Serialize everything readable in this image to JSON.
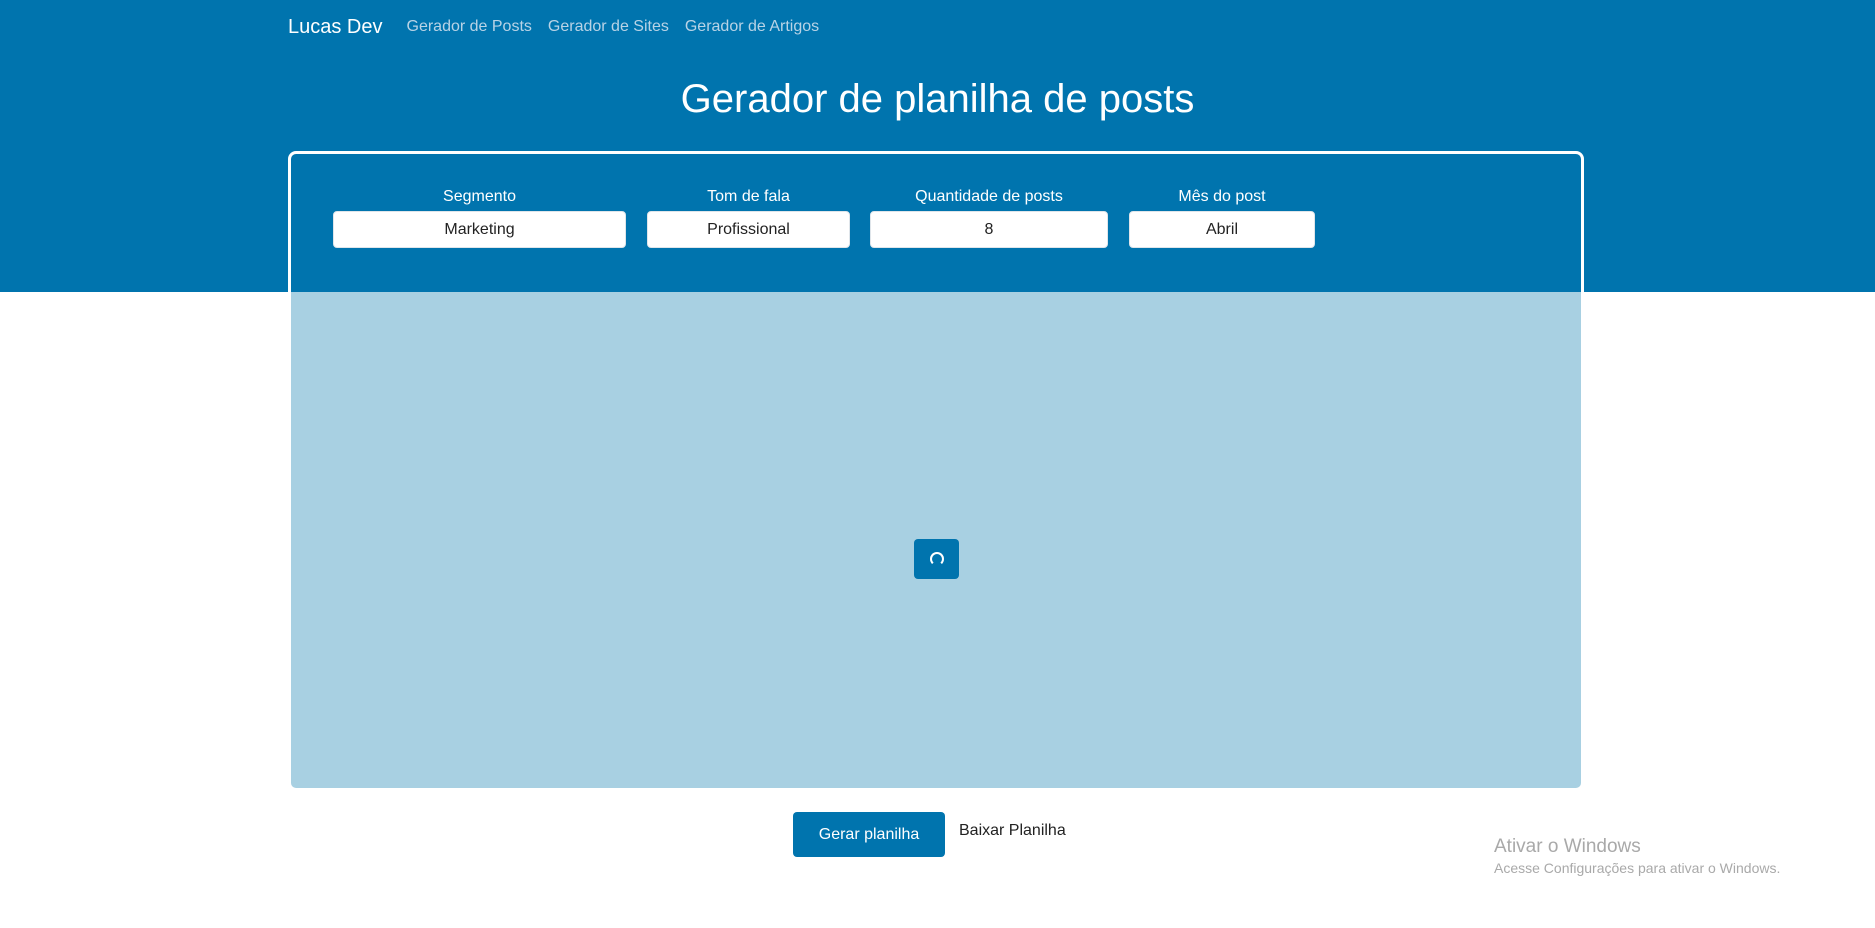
{
  "nav": {
    "brand": "Lucas Dev",
    "links": [
      "Gerador de Posts",
      "Gerador de Sites",
      "Gerador de Artigos"
    ]
  },
  "page_title": "Gerador de planilha de posts",
  "form": {
    "fields": [
      {
        "label": "Segmento",
        "value": "Marketing"
      },
      {
        "label": "Tom de fala",
        "value": "Profissional"
      },
      {
        "label": "Quantidade de posts",
        "value": "8"
      },
      {
        "label": "Mês do post",
        "value": "Abril"
      }
    ]
  },
  "actions": {
    "generate_label": "Gerar planilha",
    "download_label": "Baixar Planilha"
  },
  "watermark": {
    "title": "Ativar o Windows",
    "subtitle": "Acesse Configurações para ativar o Windows."
  },
  "colors": {
    "primary": "#0074ae",
    "overlay": "#a8d0e2",
    "nav_link": "#b8d3e6"
  }
}
